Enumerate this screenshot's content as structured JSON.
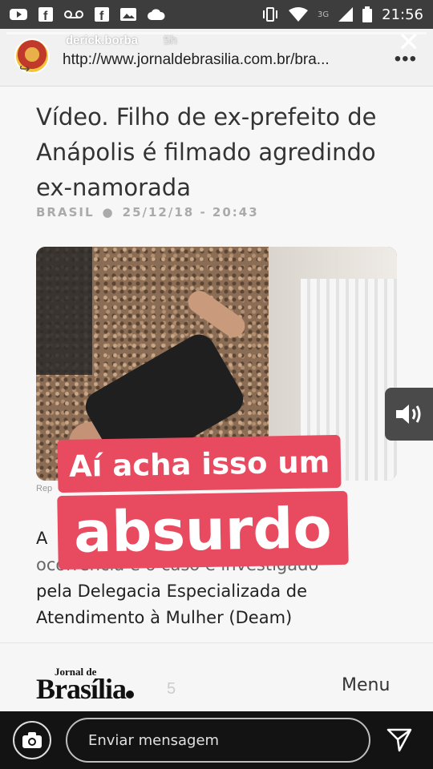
{
  "status_bar": {
    "time": "21:56",
    "signal_small": "3G"
  },
  "story": {
    "username": "derick.borba",
    "time_ago": "5h",
    "url": "http://www.jornaldebrasilia.com.br/bra...",
    "more": "•••",
    "close": "✕"
  },
  "article": {
    "headline": "Vídeo. Filho de ex-prefeito de Anápolis é filmado agredindo ex-namorada",
    "category": "BRASIL",
    "date": "25/12/18 - 20:43",
    "photo_caption": "Rep",
    "body_line1": "A",
    "body_line2": "ocorrência e o caso é investigado",
    "body_line3": "pela  Delegacia Especializada de",
    "body_line4": "Atendimento à Mulher (Deam)"
  },
  "stickers": {
    "line1": "Aí acha isso um",
    "line2": "absurdo"
  },
  "footer": {
    "logo_top": "Jornal de",
    "logo_main": "Brasília",
    "ghost": "5",
    "menu": "Menu"
  },
  "message_bar": {
    "placeholder": "Enviar mensagem"
  },
  "colors": {
    "sticker_bg": "#e84a5f",
    "status_bar": "#3d3d3d",
    "message_bar": "#131313"
  }
}
